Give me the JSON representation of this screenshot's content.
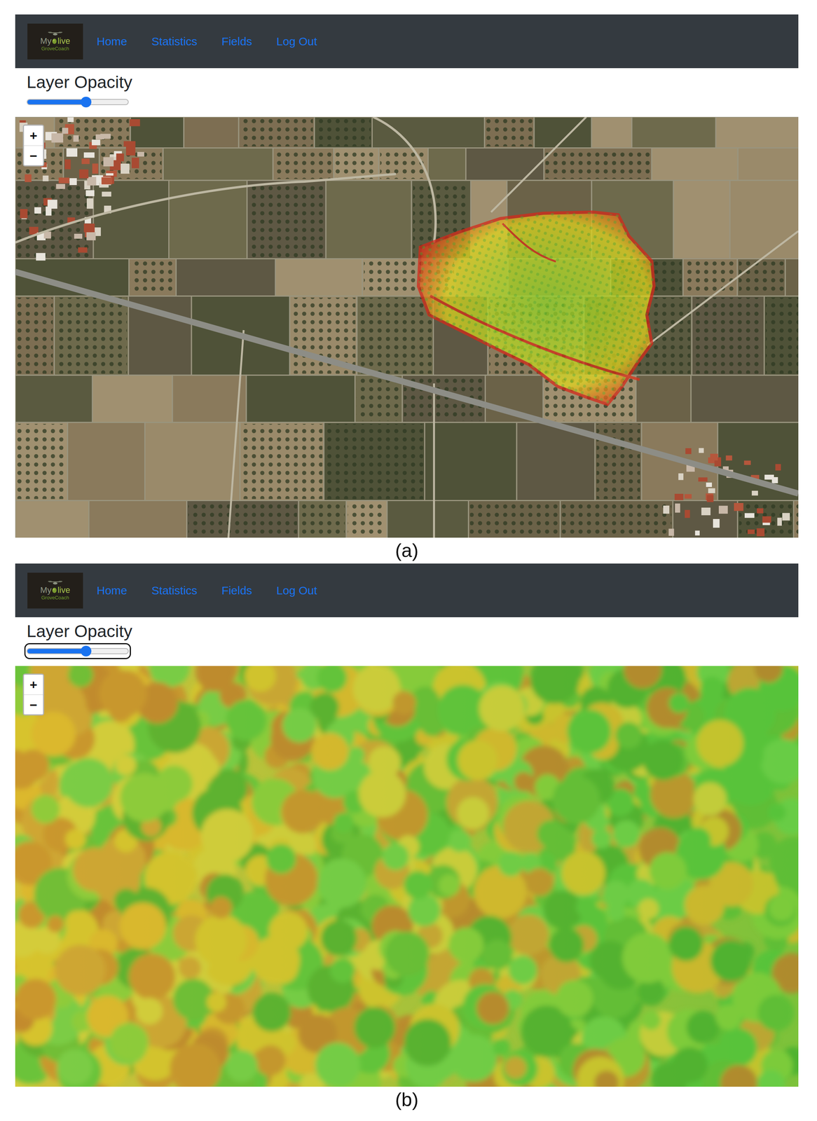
{
  "panels": [
    {
      "caption": "(a)",
      "logo": {
        "prefix": "My",
        "suffix": "live",
        "tagline": "GroveCoach"
      },
      "nav": [
        {
          "label": "Home"
        },
        {
          "label": "Statistics"
        },
        {
          "label": "Fields"
        },
        {
          "label": "Log Out"
        }
      ],
      "opacity": {
        "label": "Layer Opacity",
        "level": 0.59,
        "focused": false
      },
      "zoom": [
        "+",
        "−"
      ],
      "view": "overview"
    },
    {
      "caption": "(b)",
      "logo": {
        "prefix": "My",
        "suffix": "live",
        "tagline": "GroveCoach"
      },
      "nav": [
        {
          "label": "Home"
        },
        {
          "label": "Statistics"
        },
        {
          "label": "Fields"
        },
        {
          "label": "Log Out"
        }
      ],
      "opacity": {
        "label": "Layer Opacity",
        "level": 0.59,
        "focused": true
      },
      "zoom": [
        "+",
        "−"
      ],
      "view": "closeup"
    }
  ]
}
